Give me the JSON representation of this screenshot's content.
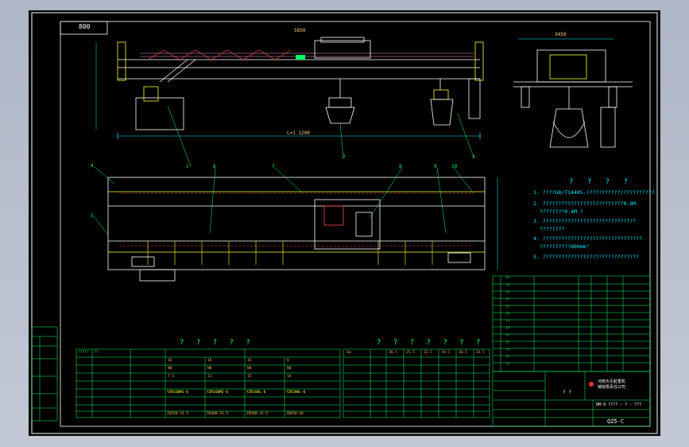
{
  "drawing": {
    "corner_tag": "800",
    "dim_top": "5850",
    "dim_span": "L=1 1200",
    "side_dim": "3450",
    "notes_title": "? ? ? ?",
    "notes": [
      "1. ????GB/T14405-(??????????)??????????",
      "2. ??????????????????????????0.8M",
      "    ????????0.4M ?",
      "3. ??????????????????????????????",
      "    ????????",
      "4. ????????????????????????????????",
      "    ??????????800mm²",
      "5. ???????????????????????????????"
    ],
    "table_left_title": "? ? ? ? ?",
    "table_mid_title": "? ? ? ? ? ? ?",
    "title_block": {
      "company_line1": "河南大巨起重机",
      "company_line2": "械有限责任公司",
      "drawing_no": "БM-9  ???? - ? - ???",
      "model": "QZ5-C",
      "stamp": "? ?"
    },
    "callouts": [
      "1",
      "2",
      "3",
      "4",
      "5",
      "6",
      "7",
      "8",
      "9",
      "10",
      "11"
    ],
    "table_left_rows": [
      [
        "?????",
        "??",
        "",
        "",
        "",
        "",
        ""
      ],
      [
        "??????",
        "16",
        "16",
        "16",
        "8",
        "8"
      ],
      [
        "",
        "N8",
        "N8",
        "N8",
        "N8",
        "N8"
      ],
      [
        "",
        "7.5",
        "11",
        "15",
        "16",
        "22"
      ],
      [
        "YZR160M1-6",
        "YZR160M2-6",
        "YZR180L-6",
        "YZR200L-6",
        "YZR225M-8"
      ],
      [
        "ZQ350-31.5",
        "ZQ400-31.5",
        "ZQ500-31.5",
        "ZQ650-40",
        "ZQ850-40"
      ]
    ],
    "table_mid_header": [
      "Sm",
      "28.5",
      "25.5",
      "22.5",
      "19.5",
      "16.5",
      "13.5",
      "10.5"
    ],
    "title_block_rows": [
      "??",
      "??",
      "??",
      "??",
      "??",
      "??",
      "??",
      "??",
      "??",
      "??",
      "??",
      "??",
      "??"
    ]
  },
  "colors": {
    "background": "#000000",
    "frame": "#ffffff",
    "structure": "#ffffff",
    "accent_yellow": "#ffff33",
    "accent_green": "#00ff66",
    "accent_cyan": "#00e8ff",
    "accent_red": "#ff3030",
    "accent_orange": "#ffb24a"
  }
}
